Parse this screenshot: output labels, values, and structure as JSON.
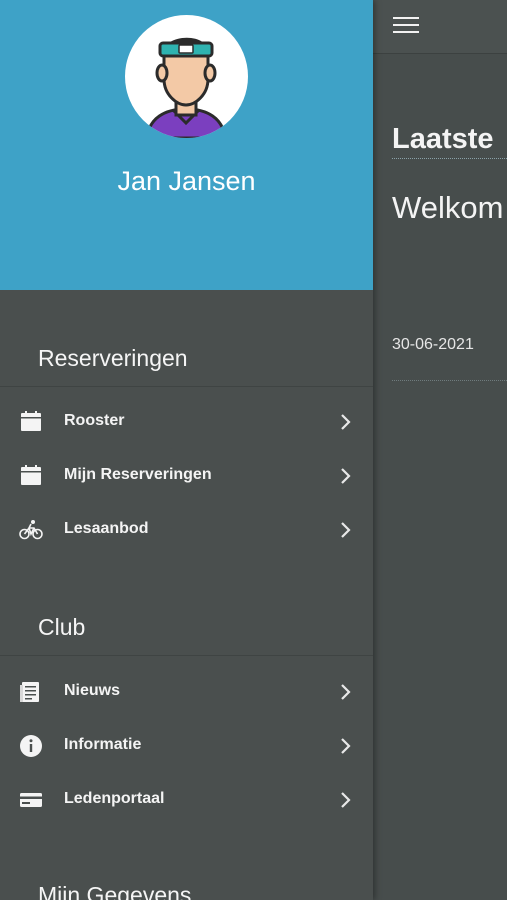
{
  "profile": {
    "name": "Jan Jansen"
  },
  "sections": {
    "reserveringen": {
      "title": "Reserveringen",
      "items": [
        {
          "label": "Rooster",
          "icon": "calendar-icon"
        },
        {
          "label": "Mijn Reserveringen",
          "icon": "calendar-icon"
        },
        {
          "label": "Lesaanbod",
          "icon": "bicycle-icon"
        }
      ]
    },
    "club": {
      "title": "Club",
      "items": [
        {
          "label": "Nieuws",
          "icon": "newspaper-icon"
        },
        {
          "label": "Informatie",
          "icon": "info-icon"
        },
        {
          "label": "Ledenportaal",
          "icon": "credit-card-icon"
        }
      ]
    },
    "gegevens": {
      "title": "Mijn Gegevens"
    }
  },
  "main": {
    "heading": "Laatste",
    "news_title": "Welkom Kooi",
    "news_date": "30-06-2021"
  },
  "colors": {
    "header_bg": "#3ea2c7",
    "drawer_bg": "#4a4f4e",
    "text": "#f4f4f4"
  }
}
